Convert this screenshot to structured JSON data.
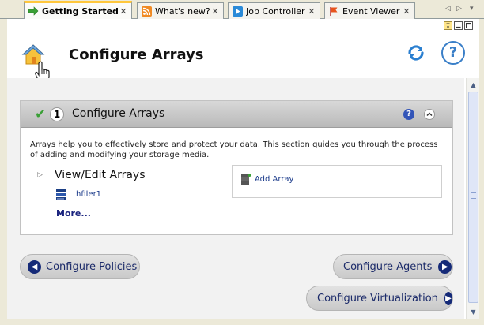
{
  "tabs": [
    {
      "label": "Getting Started",
      "icon": "green-arrow-icon",
      "active": true
    },
    {
      "label": "What's new?",
      "icon": "rss-icon",
      "active": false
    },
    {
      "label": "Job Controller",
      "icon": "play-icon",
      "active": false
    },
    {
      "label": "Event Viewer",
      "icon": "flag-icon",
      "active": false
    }
  ],
  "tab_close_glyph": "✕",
  "tab_nav": {
    "left": "◁",
    "right": "▷",
    "list": "▾"
  },
  "header": {
    "title": "Configure Arrays",
    "refresh_icon": "refresh-icon",
    "help_icon_text": "?"
  },
  "section": {
    "step_number": "1",
    "title": "Configure Arrays",
    "help_text": "?",
    "description": "Arrays help you to effectively store and protect your data. This section guides you through the process of adding and modifying your storage media.",
    "view_edit_title": "View/Edit Arrays",
    "arrays": [
      {
        "label": "hfiler1",
        "icon": "storage-array-icon"
      }
    ],
    "more_link": "More...",
    "add_array_label": "Add Array"
  },
  "actions": {
    "configure_policies": "Configure Policies",
    "configure_agents": "Configure Agents",
    "configure_virtualization": "Configure Virtualization"
  },
  "colors": {
    "active_tab_accent": "#ffc73c",
    "link_blue": "#1a3a8a",
    "button_arrow": "#152a78",
    "check_green": "#3aa036"
  }
}
